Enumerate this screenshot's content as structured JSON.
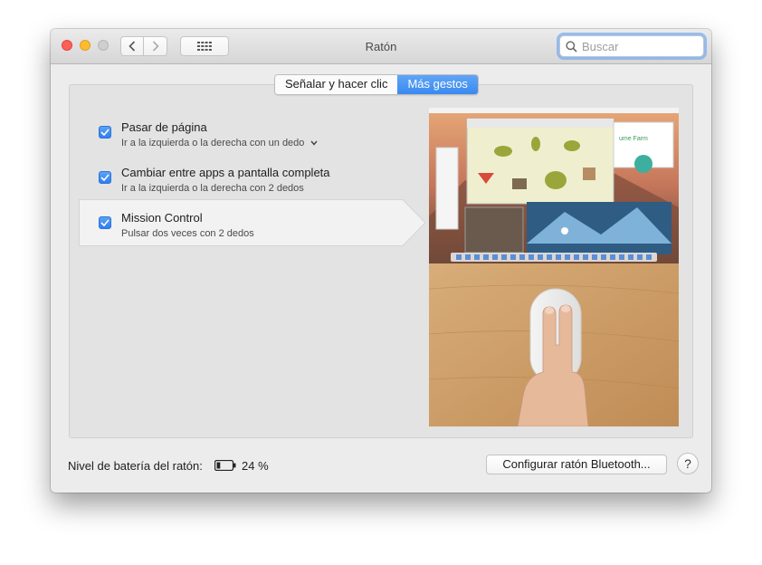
{
  "window": {
    "title": "Ratón"
  },
  "search": {
    "placeholder": "Buscar",
    "value": ""
  },
  "tabs": [
    {
      "label": "Señalar y hacer clic",
      "active": false
    },
    {
      "label": "Más gestos",
      "active": true
    }
  ],
  "gestures": [
    {
      "title": "Pasar de página",
      "subtitle": "Ir a la izquierda o la derecha con un dedo",
      "checked": true,
      "has_menu": true
    },
    {
      "title": "Cambiar entre apps a pantalla completa",
      "subtitle": "Ir a la izquierda o la derecha con 2 dedos",
      "checked": true,
      "has_menu": false
    },
    {
      "title": "Mission Control",
      "subtitle": "Pulsar dos veces con 2 dedos",
      "checked": true,
      "has_menu": false,
      "selected": true
    }
  ],
  "footer": {
    "battery_label": "Nivel de batería del ratón:",
    "battery_percent": "24 %",
    "battery_level": 0.24,
    "bluetooth_button": "Configurar ratón Bluetooth...",
    "help_label": "?"
  },
  "preview": {
    "inner_app_text": "ume Farm"
  },
  "colors": {
    "accent": "#3a89f0",
    "close": "#fc5f57",
    "minimize": "#fdbc2e",
    "wood": "#cfa06a"
  },
  "icons": [
    "back-arrow-icon",
    "forward-arrow-icon",
    "grid-icon",
    "search-icon",
    "checkmark-icon",
    "chevron-down-icon",
    "battery-icon"
  ]
}
